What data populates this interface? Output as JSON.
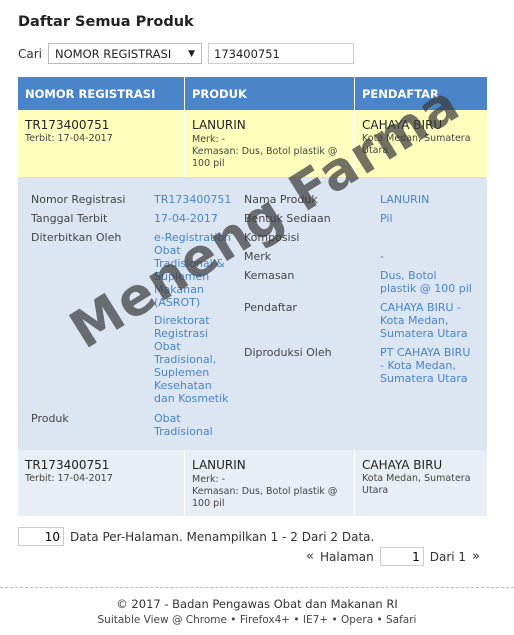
{
  "page": {
    "title": "Daftar Semua Produk"
  },
  "search": {
    "label": "Cari",
    "field": "NOMOR REGISTRASI",
    "value": "173400751"
  },
  "table": {
    "headers": [
      "NOMOR REGISTRASI",
      "PRODUK",
      "PENDAFTAR"
    ],
    "rows": [
      {
        "reg": "TR173400751",
        "terbit": "Terbit: 17-04-2017",
        "produk": "LANURIN",
        "produk_sub": "Merk: -",
        "produk_sub2": "Kemasan: Dus, Botol plastik @ 100 pil",
        "pendaftar": "CAHAYA BIRU",
        "pendaftar_sub": "Kota Medan, Sumatera Utara"
      },
      {
        "reg": "TR173400751",
        "terbit": "Terbit: 17-04-2017",
        "produk": "LANURIN",
        "produk_sub": "Merk: -",
        "produk_sub2": "Kemasan: Dus, Botol plastik @ 100 pil",
        "pendaftar": "CAHAYA BIRU",
        "pendaftar_sub": "Kota Medan, Sumatera Utara"
      }
    ],
    "detail": {
      "labels_left": {
        "nomor": "Nomor Registrasi",
        "tanggal": "Tanggal Terbit",
        "diterbitkan": "Diterbitkan Oleh",
        "produk": "Produk"
      },
      "values_left": {
        "nomor": "TR173400751",
        "tanggal": "17-04-2017",
        "diterbitkan_1": "e-Registration",
        "diterbitkan_2": "Obat",
        "diterbitkan_3": "Tradisional &",
        "diterbitkan_4": "Suplemen",
        "diterbitkan_5": "Makanan",
        "diterbitkan_6": "(ASROT)",
        "dir_1": "Direktorat",
        "dir_2": "Registrasi",
        "dir_3": "Obat",
        "dir_4": "Tradisional,",
        "dir_5": "Suplemen",
        "dir_6": "Kesehatan",
        "dir_7": "dan Kosmetik",
        "produk_1": "Obat",
        "produk_2": "Tradisional"
      },
      "labels_right": {
        "nama": "Nama Produk",
        "bentuk": "Bentuk Sediaan",
        "komposisi": "Komposisi",
        "merk": "Merk",
        "kemasan": "Kemasan",
        "pendaftar": "Pendaftar",
        "diproduksi": "Diproduksi Oleh"
      },
      "values_right": {
        "nama": "LANURIN",
        "bentuk": "Pil",
        "merk": "-",
        "kemasan_1": "Dus, Botol",
        "kemasan_2": "plastik @ 100 pil",
        "pendaftar_1": "CAHAYA BIRU -",
        "pendaftar_2": "Kota Medan,",
        "pendaftar_3": "Sumatera Utara",
        "diproduksi_1": "PT CAHAYA BIRU",
        "diproduksi_2": "- Kota Medan,",
        "diproduksi_3": "Sumatera Utara"
      }
    }
  },
  "pagination": {
    "per_page": "10",
    "info": "Data Per-Halaman. Menampilkan 1 - 2 Dari 2 Data.",
    "prev_symbol": "«",
    "halaman_label": "Halaman",
    "page": "1",
    "of_label": "Dari 1",
    "next_symbol": "»"
  },
  "footer": {
    "copyright": "© 2017 - Badan Pengawas Obat dan Makanan RI",
    "browsers": "Suitable View @ Chrome • Firefox4+ • IE7+ • Opera • Safari"
  },
  "watermark": "Meneng Farma",
  "colors": {
    "header_blue": "#4a84c9",
    "row_yellow": "#ffffbd",
    "detail_blue": "#dce6f2",
    "row_blue": "#e8eef5"
  }
}
